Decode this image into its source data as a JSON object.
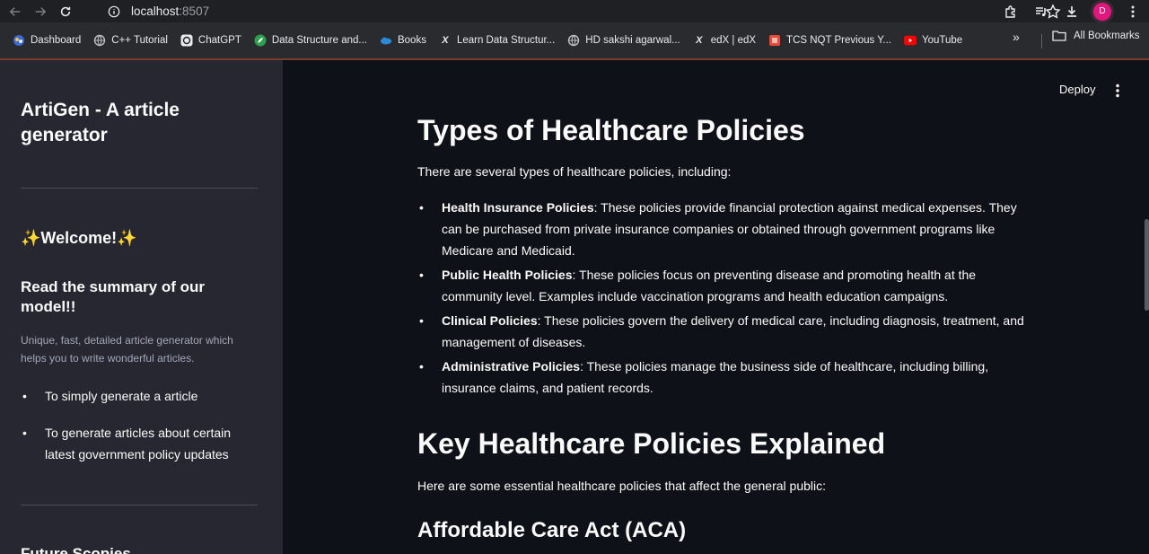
{
  "browser": {
    "url_host": "localhost",
    "url_port": ":8507",
    "avatar_letter": "D",
    "avatar_color": "#e0177d",
    "bookmarks": [
      {
        "label": "Dashboard",
        "icon": "dashboard-icon"
      },
      {
        "label": "C++ Tutorial",
        "icon": "globe-icon"
      },
      {
        "label": "ChatGPT",
        "icon": "chatgpt-icon"
      },
      {
        "label": "Data Structure and...",
        "icon": "leaf-icon"
      },
      {
        "label": "Books",
        "icon": "cloud-icon"
      },
      {
        "label": "Learn Data Structur...",
        "icon": "x-icon"
      },
      {
        "label": "HD sakshi agarwal...",
        "icon": "globe-icon"
      },
      {
        "label": "edX | edX",
        "icon": "x-icon"
      },
      {
        "label": "TCS NQT Previous Y...",
        "icon": "bookmark-red-icon"
      },
      {
        "label": "YouTube",
        "icon": "youtube-icon"
      }
    ],
    "more_label": "»",
    "all_bookmarks_label": "All Bookmarks"
  },
  "sidebar": {
    "title": "ArtiGen - A article generator",
    "welcome": "✨Welcome!✨",
    "subheading": "Read the summary of our model!!",
    "caption": "Unique, fast, detailed article generator which helps you to write wonderful articles.",
    "items": [
      "To simply generate a article",
      "To generate articles about certain latest government policy updates"
    ],
    "partial_heading": "Future Scopies"
  },
  "header": {
    "deploy_label": "Deploy"
  },
  "article": {
    "h_types": "Types of Healthcare Policies",
    "intro_types": "There are several types of healthcare policies, including:",
    "policies": [
      {
        "name": "Health Insurance Policies",
        "text": ": These policies provide financial protection against medical expenses. They can be purchased from private insurance companies or obtained through government programs like Medicare and Medicaid."
      },
      {
        "name": "Public Health Policies",
        "text": ": These policies focus on preventing disease and promoting health at the community level. Examples include vaccination programs and health education campaigns."
      },
      {
        "name": "Clinical Policies",
        "text": ": These policies govern the delivery of medical care, including diagnosis, treatment, and management of diseases."
      },
      {
        "name": "Administrative Policies",
        "text": ": These policies manage the business side of healthcare, including billing, insurance claims, and patient records."
      }
    ],
    "h_key": "Key Healthcare Policies Explained",
    "intro_key": "Here are some essential healthcare policies that affect the general public:",
    "h_aca": "Affordable Care Act (ACA)"
  }
}
